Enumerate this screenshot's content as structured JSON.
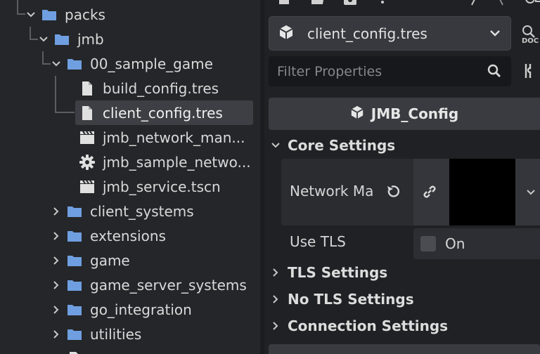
{
  "tree": {
    "items": [
      {
        "label": "packs",
        "icon": "folder-icon",
        "arrow": "expanded"
      },
      {
        "label": "jmb",
        "icon": "folder-icon",
        "arrow": "expanded"
      },
      {
        "label": "00_sample_game",
        "icon": "folder-icon",
        "arrow": "expanded"
      },
      {
        "label": "build_config.tres",
        "icon": "file-icon"
      },
      {
        "label": "client_config.tres",
        "icon": "file-icon",
        "selected": true
      },
      {
        "label": "jmb_network_man...",
        "icon": "scene-icon"
      },
      {
        "label": "jmb_sample_netwo...",
        "icon": "gear-icon"
      },
      {
        "label": "jmb_service.tscn",
        "icon": "scene-icon"
      },
      {
        "label": "client_systems",
        "icon": "folder-icon",
        "arrow": "collapsed"
      },
      {
        "label": "extensions",
        "icon": "folder-icon",
        "arrow": "collapsed"
      },
      {
        "label": "game",
        "icon": "folder-icon",
        "arrow": "collapsed"
      },
      {
        "label": "game_server_systems",
        "icon": "folder-icon",
        "arrow": "collapsed"
      },
      {
        "label": "go_integration",
        "icon": "folder-icon",
        "arrow": "collapsed"
      },
      {
        "label": "utilities",
        "icon": "folder-icon",
        "arrow": "collapsed"
      }
    ]
  },
  "inspector": {
    "resource_name": "client_config.tres",
    "filter_placeholder": "Filter Properties",
    "class_name": "JMB_Config",
    "sections": {
      "core": "Core Settings",
      "tls": "TLS Settings",
      "no_tls": "No TLS Settings",
      "connection": "Connection Settings"
    },
    "properties": {
      "network_manager_label": "Network Ma",
      "use_tls_label": "Use TLS",
      "use_tls_value": "On"
    }
  },
  "colors": {
    "folder": "#6f9fe0",
    "accent_text": "#e6e6e6"
  }
}
